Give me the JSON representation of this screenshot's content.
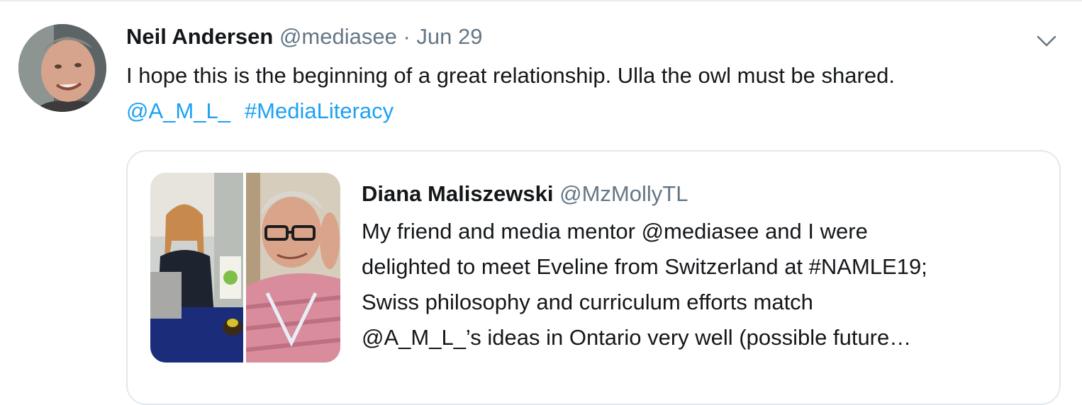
{
  "tweet": {
    "author_name": "Neil Andersen",
    "author_handle": "@mediasee",
    "separator": "·",
    "date": "Jun 29",
    "text": "I hope this is the beginning of a great relationship. Ulla the owl must be shared.",
    "mentions": [
      "@A_M_L_",
      "#MediaLiteracy"
    ],
    "menu_icon": "chevron-down-icon"
  },
  "quoted": {
    "author_name": "Diana Maliszewski",
    "author_handle": "@MzMollyTL",
    "text_lines": [
      "My friend and media mentor @mediasee and I were",
      "delighted to meet Eveline from Switzerland at #NAMLE19;",
      "Swiss philosophy and curriculum efforts match",
      "@A_M_L_’s ideas in Ontario very well (possible future…"
    ]
  },
  "colors": {
    "link": "#1da1f2",
    "secondary_text": "#657786",
    "border": "#e1e8ed"
  }
}
